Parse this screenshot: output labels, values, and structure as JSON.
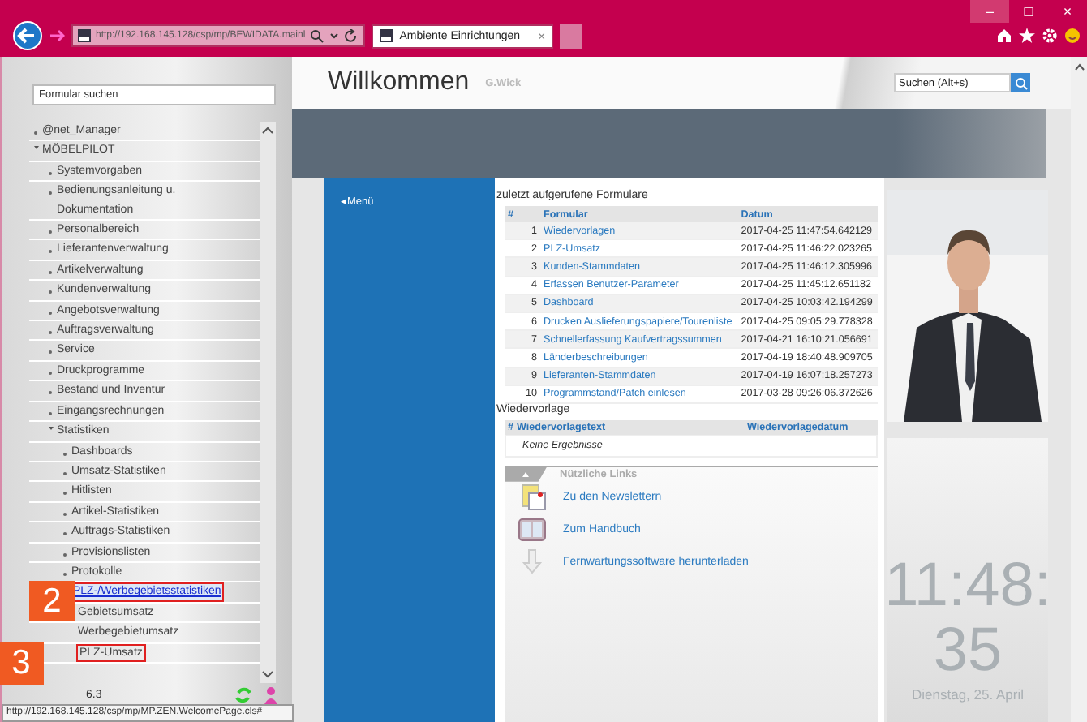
{
  "browser": {
    "address": "http://192.168.145.128/csp/mp/BEWIDATA.mainl",
    "tab": "Ambiente Einrichtungen",
    "tab_close": "×",
    "window_buttons": [
      "–",
      "□",
      "×"
    ]
  },
  "sidebar": {
    "search": {
      "placeholder": "Formular suchen"
    },
    "tree": [
      {
        "label": "@net_Manager",
        "expanded": false
      },
      {
        "label": "MÖBELPILOT",
        "expanded": true,
        "children": [
          {
            "label": "Systemvorgaben",
            "expanded": false
          },
          {
            "label": "Bedienungsanleitung u. Dokumentation",
            "expanded": false
          },
          {
            "label": "Personalbereich",
            "expanded": false
          },
          {
            "label": "Lieferantenverwaltung",
            "expanded": false
          },
          {
            "label": "Artikelverwaltung",
            "expanded": false
          },
          {
            "label": "Kundenverwaltung",
            "expanded": false
          },
          {
            "label": "Angebotsverwaltung",
            "expanded": false
          },
          {
            "label": "Auftragsverwaltung",
            "expanded": false
          },
          {
            "label": "Service",
            "expanded": false
          },
          {
            "label": "Druckprogramme",
            "expanded": false
          },
          {
            "label": "Bestand und Inventur",
            "expanded": false
          },
          {
            "label": "Eingangsrechnungen",
            "expanded": false
          },
          {
            "label": "Statistiken",
            "expanded": true,
            "children": [
              {
                "label": "Dashboards",
                "expanded": false
              },
              {
                "label": "Umsatz-Statistiken",
                "expanded": false
              },
              {
                "label": "Hitlisten",
                "expanded": false
              },
              {
                "label": "Artikel-Statistiken",
                "expanded": false
              },
              {
                "label": "Auftrags-Statistiken",
                "expanded": false
              },
              {
                "label": "Provisionslisten",
                "expanded": false
              },
              {
                "label": "Protokolle",
                "expanded": false
              },
              {
                "label": "PLZ-/Werbegebietsstatistiken",
                "expanded": true,
                "selected": true,
                "callout": "2",
                "children": [
                  {
                    "label": "Gebietsumsatz",
                    "selected": false
                  },
                  {
                    "label": "Werbegebietumsatz",
                    "selected": false
                  },
                  {
                    "label": "PLZ-Umsatz",
                    "selected": false,
                    "callout": "3"
                  }
                ]
              }
            ]
          }
        ]
      }
    ],
    "version": "6.3",
    "status_url": "http://192.168.145.128/csp/mp/MP.ZEN.WelcomePage.cls#"
  },
  "header": {
    "title": "Willkommen",
    "user": "G.Wick",
    "search": {
      "placeholder": "Suchen (Alt+s)"
    }
  },
  "menu_toggle": "◂Menü",
  "recent": {
    "title": "zuletzt aufgerufene Formulare",
    "columns": [
      "#",
      "Formular",
      "Datum"
    ],
    "rows": [
      [
        "1",
        "Wiedervorlagen",
        "2017-04-25 11:47:54.642129"
      ],
      [
        "2",
        "PLZ-Umsatz",
        "2017-04-25 11:46:22.023265"
      ],
      [
        "3",
        "Kunden-Stammdaten",
        "2017-04-25 11:46:12.305996"
      ],
      [
        "4",
        "Erfassen Benutzer-Parameter",
        "2017-04-25 11:45:12.651182"
      ],
      [
        "5",
        "Dashboard",
        "2017-04-25 10:03:42.194299"
      ],
      [
        "6",
        "Drucken Auslieferungspapiere/Tourenliste",
        "2017-04-25 09:05:29.778328"
      ],
      [
        "7",
        "Schnellerfassung Kaufvertragssummen",
        "2017-04-21 16:10:21.056691"
      ],
      [
        "8",
        "Länderbeschreibungen",
        "2017-04-19 18:40:48.909705"
      ],
      [
        "9",
        "Lieferanten-Stammdaten",
        "2017-04-19 16:07:18.257273"
      ],
      [
        "10",
        "Programmstand/Patch einlesen",
        "2017-03-28 09:26:06.372626"
      ]
    ]
  },
  "followups": {
    "title": "Wiedervorlage",
    "columns": [
      "#",
      "Wiedervorlagetext",
      "Wiedervorlagedatum"
    ],
    "empty": "Keine Ergebnisse"
  },
  "links": {
    "title": "Nützliche Links",
    "items": [
      {
        "kind": "newsletter",
        "label": "Zu den Newslettern"
      },
      {
        "kind": "handbook",
        "label": "Zum Handbuch"
      },
      {
        "kind": "download",
        "label": "Fernwartungssoftware herunterladen"
      }
    ]
  },
  "clock": {
    "time": "11:48:",
    "seconds": "35",
    "date": "Dienstag, 25. April"
  }
}
